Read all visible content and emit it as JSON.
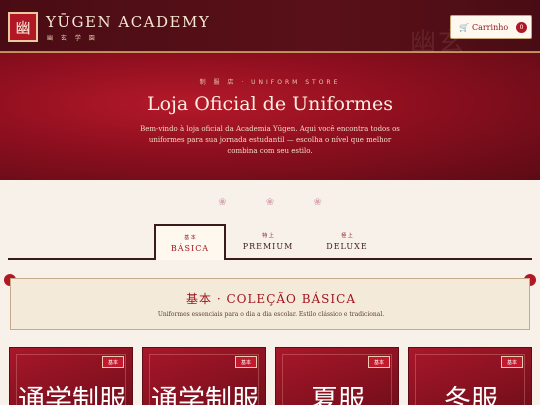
{
  "header": {
    "logo_glyph": "幽",
    "brand_name": "YŪGEN ACADEMY",
    "brand_sub": "幽 玄 学 園",
    "watermark": "幽玄",
    "cart": {
      "icon": "cart-icon",
      "glyph": "🛒",
      "label": "Carrinho",
      "count": "0"
    }
  },
  "hero": {
    "kicker": "制 服 店 · UNIFORM STORE",
    "title": "Loja Oficial de Uniformes",
    "description": "Bem-vindo à loja oficial da Academia Yūgen. Aqui você encontra todos os uniformes para sua jornada estudantil — escolha o nível que melhor combina com seu estilo."
  },
  "decor": {
    "flowers": "❀ ❀ ❀"
  },
  "tabs": [
    {
      "kanji": "基 本",
      "label": "BÁSICA",
      "active": true
    },
    {
      "kanji": "特 上",
      "label": "PREMIUM",
      "active": false
    },
    {
      "kanji": "極 上",
      "label": "DELUXE",
      "active": false
    }
  ],
  "collection": {
    "title": "基本 · COLEÇÃO BÁSICA",
    "subtitle": "Uniformes essenciais para o dia a dia escolar. Estilo clássico e tradicional."
  },
  "cards": [
    {
      "badge": "基本",
      "kanji": "通学制服"
    },
    {
      "badge": "基本",
      "kanji": "通学制服"
    },
    {
      "badge": "基本",
      "kanji": "夏服"
    },
    {
      "badge": "基本",
      "kanji": "冬服"
    }
  ],
  "colors": {
    "accent": "#b01825",
    "header_bg": "#4a0c14",
    "page_bg": "#f7f1ea",
    "banner_bg": "#f4ead9"
  }
}
